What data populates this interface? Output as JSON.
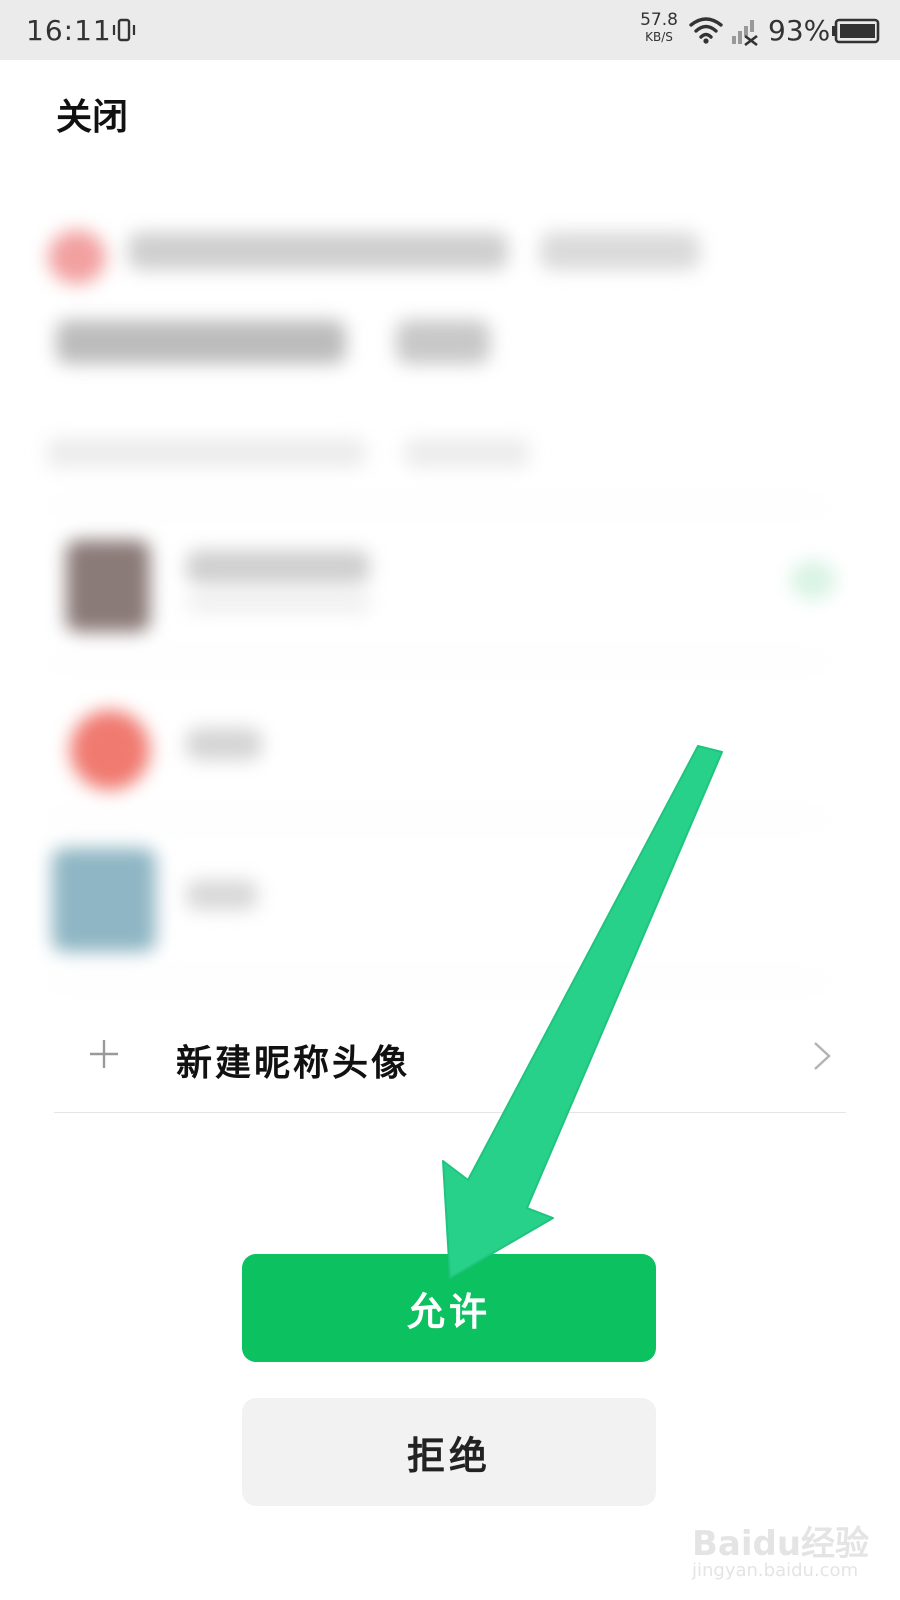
{
  "status_bar": {
    "time": "16:11",
    "net_speed_value": "57.8",
    "net_speed_unit": "KB/S",
    "battery_percent": "93%"
  },
  "header": {
    "close_label": "关闭"
  },
  "profile_options": {
    "new_profile_label": "新建昵称头像"
  },
  "actions": {
    "allow_label": "允许",
    "deny_label": "拒绝"
  },
  "watermark": {
    "brand": "Baidu经验",
    "domain": "jingyan.baidu.com"
  },
  "colors": {
    "accent_green": "#0bc160",
    "annotation_arrow": "#27d18a",
    "status_bar_bg": "#ebebeb",
    "deny_button_bg": "#f2f2f2"
  },
  "icons": {
    "status": [
      "vibrate-icon",
      "wifi-icon",
      "signal-icon",
      "battery-icon"
    ],
    "row": [
      "plus-icon",
      "chevron-right-icon"
    ]
  }
}
